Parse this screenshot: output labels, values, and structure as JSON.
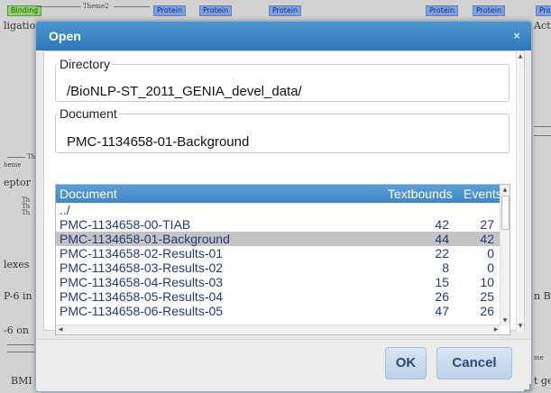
{
  "dialog": {
    "title": "Open",
    "close_glyph": "×",
    "directory": {
      "legend": "Directory",
      "value": "/BioNLP-ST_2011_GENIA_devel_data/"
    },
    "document": {
      "legend": "Document",
      "value": "PMC-1134658-01-Background"
    },
    "table": {
      "columns": [
        "Document",
        "Textbounds",
        "Events"
      ],
      "parent_row": "../",
      "rows": [
        {
          "name": "PMC-1134658-00-TIAB",
          "textbounds": "42",
          "events": "27",
          "selected": false
        },
        {
          "name": "PMC-1134658-01-Background",
          "textbounds": "44",
          "events": "42",
          "selected": true
        },
        {
          "name": "PMC-1134658-02-Results-01",
          "textbounds": "22",
          "events": "0",
          "selected": false
        },
        {
          "name": "PMC-1134658-03-Results-02",
          "textbounds": "8",
          "events": "0",
          "selected": false
        },
        {
          "name": "PMC-1134658-04-Results-03",
          "textbounds": "15",
          "events": "10",
          "selected": false
        },
        {
          "name": "PMC-1134658-05-Results-04",
          "textbounds": "26",
          "events": "25",
          "selected": false
        },
        {
          "name": "PMC-1134658-06-Results-05",
          "textbounds": "47",
          "events": "26",
          "selected": false
        }
      ]
    },
    "buttons": {
      "ok": "OK",
      "cancel": "Cancel"
    }
  },
  "background": {
    "tags": [
      "Binding",
      "Protein",
      "Protein",
      "Protein",
      "Protein",
      "Protein",
      "Pro"
    ],
    "words": [
      "ligatio",
      "Act-I",
      "eptor",
      "lexes",
      "P-6 in",
      "n B",
      "-6 on",
      "BMI",
      "t ge"
    ],
    "small_labels": [
      "Theme2",
      "Th",
      "heme",
      "Th",
      "Th",
      "Th",
      "me"
    ]
  },
  "colors": {
    "titlebar": "#3a84c4",
    "table_header": "#4a8fcc",
    "selected_row": "#c4c4c4",
    "row_text": "#223a7a",
    "button_text": "#2d4a73"
  },
  "icons": [
    "close-icon",
    "scroll-up-arrow-icon",
    "scroll-down-arrow-icon",
    "scroll-left-arrow-icon",
    "scroll-right-arrow-icon",
    "resize-grip-icon"
  ]
}
